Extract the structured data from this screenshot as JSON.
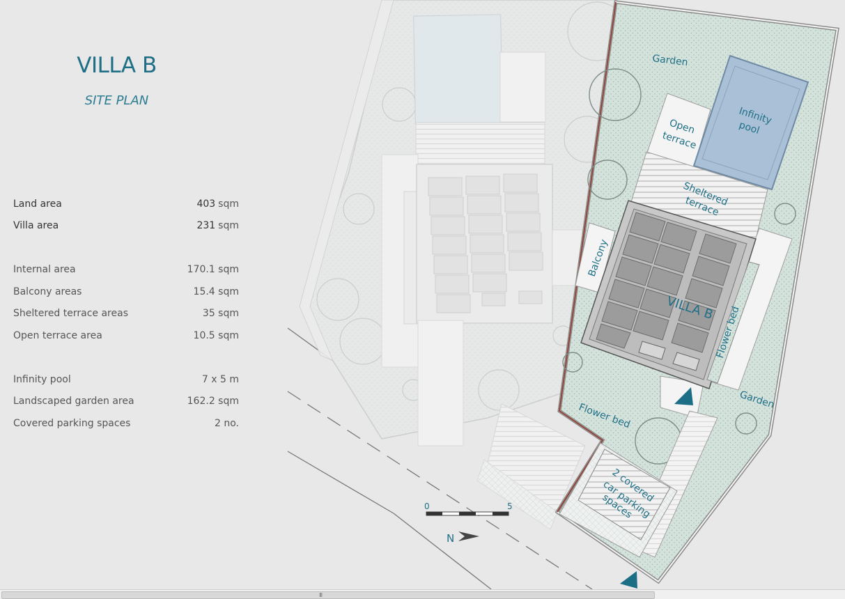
{
  "header": {
    "title": "VILLA B",
    "subtitle": "SITE PLAN"
  },
  "areas": [
    {
      "label": "Land area",
      "value": "403",
      "unit": "sqm"
    },
    {
      "label": "Villa area",
      "value": "231",
      "unit": "sqm"
    }
  ],
  "details": [
    {
      "label": "Internal area",
      "value": "170.1 sqm"
    },
    {
      "label": "Balcony areas",
      "value": "15.4 sqm"
    },
    {
      "label": "Sheltered terrace areas",
      "value": "35 sqm"
    },
    {
      "label": "Open terrace area",
      "value": "10.5 sqm"
    }
  ],
  "amenities": [
    {
      "label": "Infinity pool",
      "value": "7 x 5 m"
    },
    {
      "label": "Landscaped garden area",
      "value": "162.2 sqm"
    },
    {
      "label": "Covered parking spaces",
      "value": "2 no."
    }
  ],
  "plan": {
    "garden_top": "Garden",
    "infinity_pool_1": "Infinity",
    "infinity_pool_2": "pool",
    "open_terrace_1": "Open",
    "open_terrace_2": "terrace",
    "sheltered_1": "Sheltered",
    "sheltered_2": "terrace",
    "balcony": "Balcony",
    "villa": "VILLA B",
    "flower_bed_right": "Flower bed",
    "flower_bed_bottom": "Flower bed",
    "garden_right": "Garden",
    "parking_1": "2 covered",
    "parking_2": "car parking",
    "parking_3": "spaces",
    "scale_start": "0",
    "scale_end": "5",
    "north": "N"
  },
  "colors": {
    "accent": "#1e6e86",
    "garden": "#d6e3de",
    "pool": "#a9c0d6",
    "boundary": "#8b3a2e"
  },
  "scrollbar": {
    "grip": "III"
  }
}
